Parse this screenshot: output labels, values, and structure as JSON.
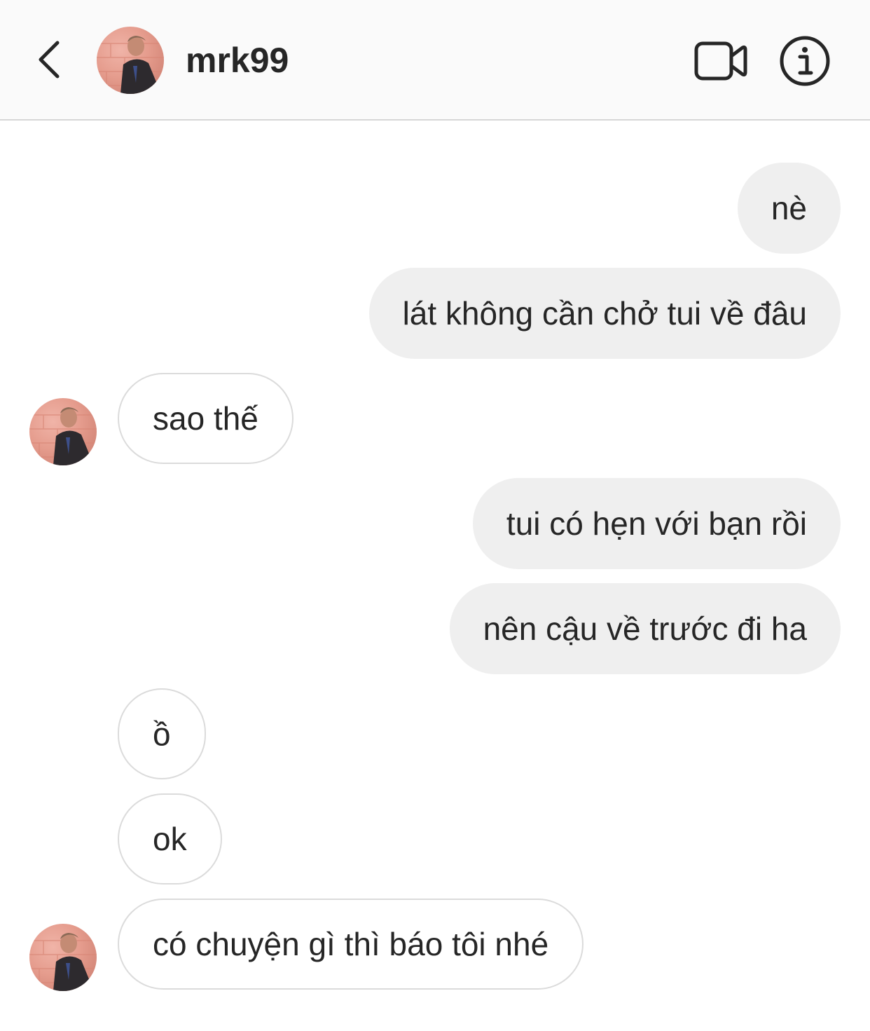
{
  "header": {
    "username": "mrk99",
    "back_icon": "chevron-left-icon",
    "video_icon": "video-camera-icon",
    "info_icon": "info-icon"
  },
  "colors": {
    "header_bg": "#fafafa",
    "sent_bubble_bg": "#efefef",
    "received_bubble_border": "#dbdbdb",
    "text": "#262626"
  },
  "messages": [
    {
      "from": "me",
      "text": "nè"
    },
    {
      "from": "me",
      "text": "lát không cần chở tui về đâu"
    },
    {
      "from": "them",
      "text": "sao thế"
    },
    {
      "from": "me",
      "text": "tui có hẹn với bạn rồi"
    },
    {
      "from": "me",
      "text": "nên cậu về trước đi ha"
    },
    {
      "from": "them",
      "text": "ồ"
    },
    {
      "from": "them",
      "text": "ok"
    },
    {
      "from": "them",
      "text": "có chuyện gì thì báo tôi nhé"
    }
  ]
}
